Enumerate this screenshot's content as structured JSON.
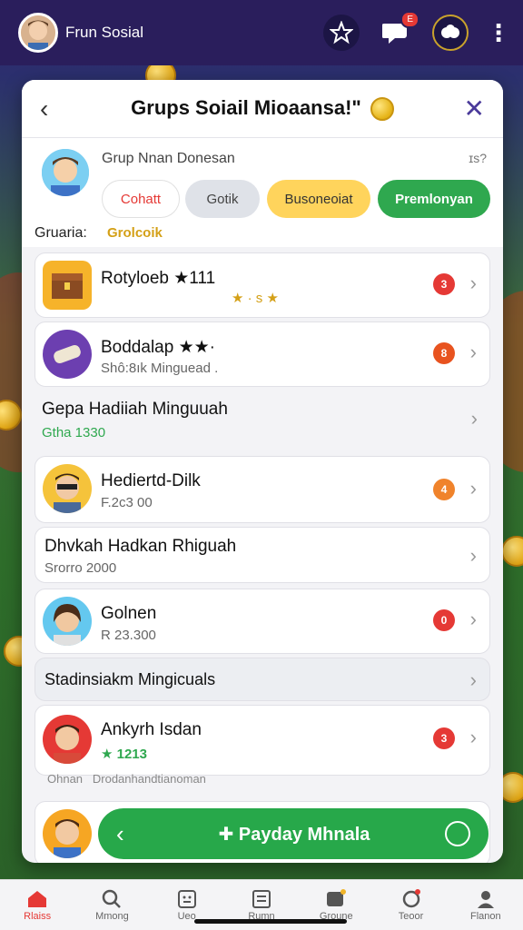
{
  "topbar": {
    "app_name": "Frun Sosial",
    "badge_notifications": "E"
  },
  "modal": {
    "title": "Grups Soiail Mioaansa!\"",
    "group": {
      "name": "Grup Nnan Donesan",
      "help": "ɪs?",
      "chips": [
        "Cohatt",
        "Gotik",
        "Busoneoiat",
        "Premlonyan"
      ],
      "label": "Gruaria:",
      "value": "Grolcoik"
    },
    "items": [
      {
        "title": "Rotyloeb ★111",
        "sub": "",
        "extra": "★ · s ★",
        "badge": "3"
      },
      {
        "title": "Boddalap ★★·",
        "sub": "Shô:8ık Minguead .",
        "badge": "8"
      },
      {
        "title": "Gepa Hadiiah Minguuah",
        "sub": "Gtha 1330"
      },
      {
        "title": "Hediertd-Dilk",
        "sub": "F.2c3 00",
        "badge": "4"
      },
      {
        "title": "Dhvkah Hadkan Rhiguah",
        "sub": "Srorro 2000"
      },
      {
        "title": "Golnen",
        "sub": "R 23.300",
        "badge": "0"
      },
      {
        "title": "Stadinsiakm Mingicuals"
      },
      {
        "title": "Ankyrh Isdan",
        "sub": "★ 1213",
        "badge": "3"
      }
    ],
    "strip_text": "Ohnan   Drodanhandtianoman"
  },
  "payday": {
    "label": "Payday Mhnala"
  },
  "bottomnav": {
    "items": [
      {
        "label": "Rlaiss"
      },
      {
        "label": "Mmong"
      },
      {
        "label": "Ueo"
      },
      {
        "label": "Rumn"
      },
      {
        "label": "Groune"
      },
      {
        "label": "Teoor"
      },
      {
        "label": "Flanon"
      }
    ]
  },
  "colors": {
    "accent_green": "#2fa84f",
    "badge_red": "#e53935",
    "header_bg": "#2a1e5c"
  }
}
